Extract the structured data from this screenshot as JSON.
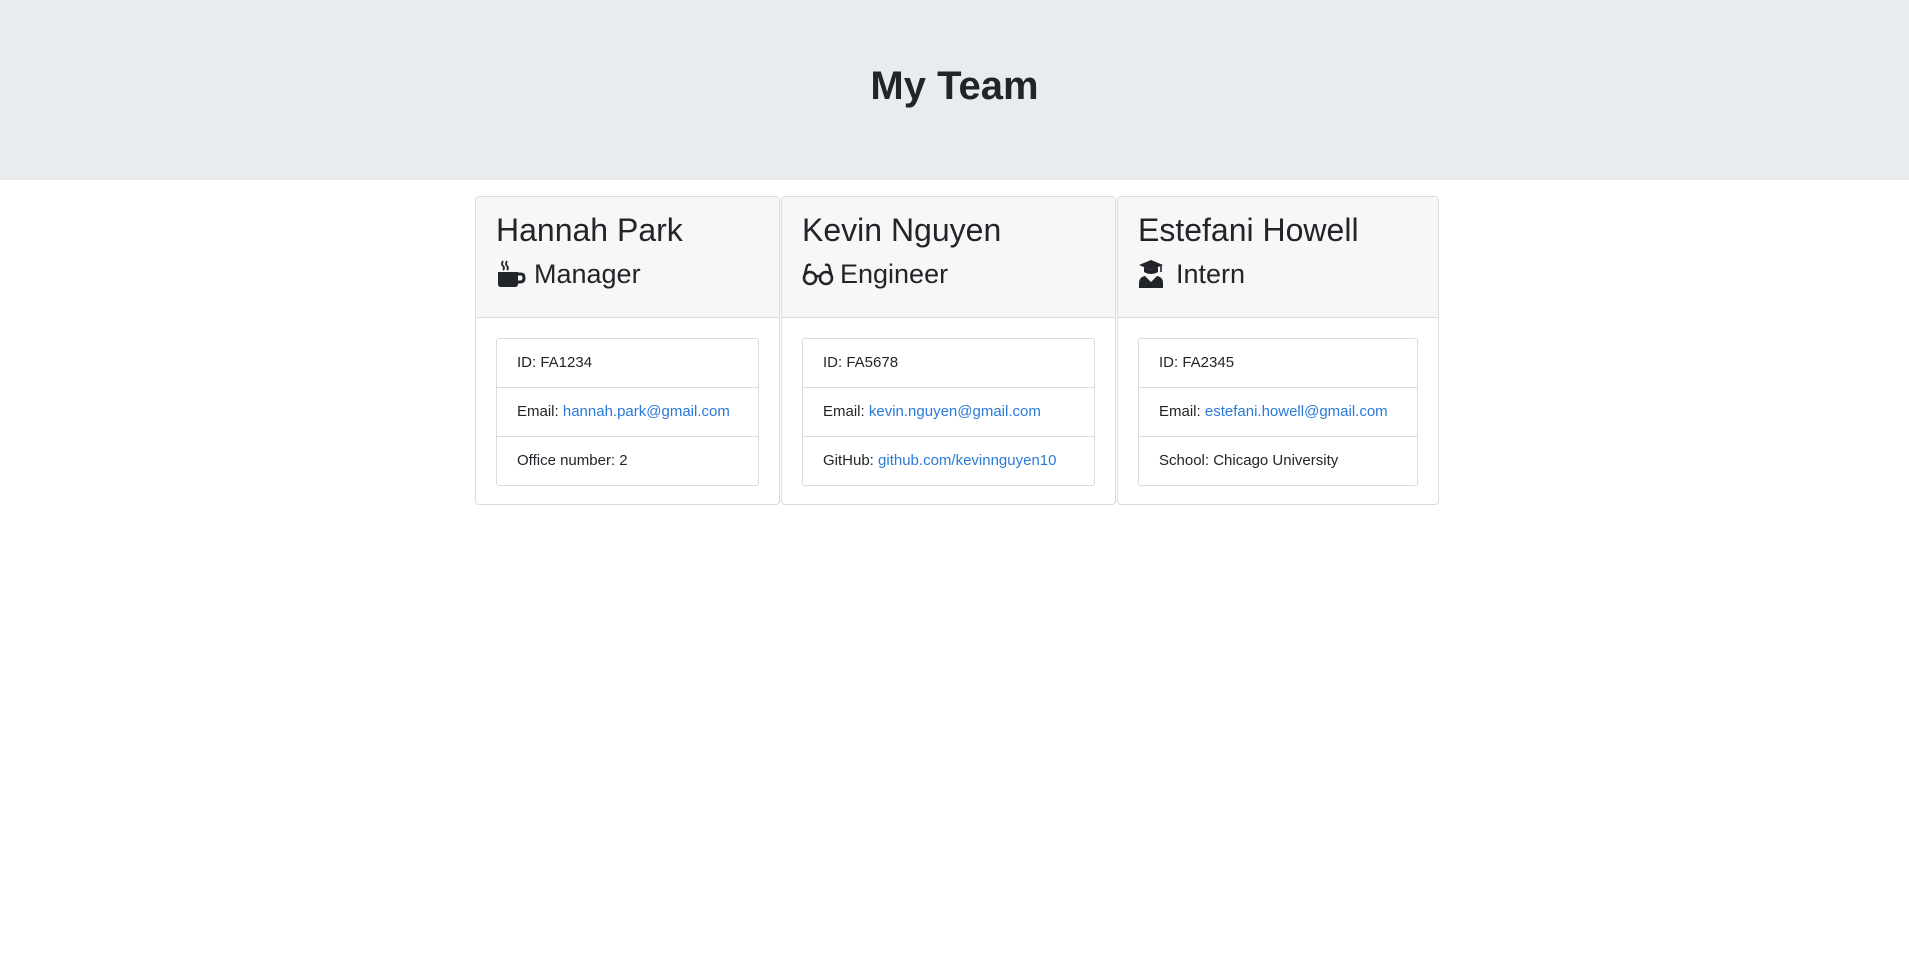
{
  "header": {
    "title": "My Team"
  },
  "employees": [
    {
      "name": "Hannah Park",
      "role": "Manager",
      "role_icon": "coffee-mug-icon",
      "id_label": "ID:",
      "id": "FA1234",
      "email_label": "Email:",
      "email": "hannah.park@gmail.com",
      "extra_label": "Office number:",
      "extra_value": "2"
    },
    {
      "name": "Kevin Nguyen",
      "role": "Engineer",
      "role_icon": "glasses-icon",
      "id_label": "ID:",
      "id": "FA5678",
      "email_label": "Email:",
      "email": "kevin.nguyen@gmail.com",
      "extra_label": "GitHub:",
      "extra_value": "github.com/kevinnguyen10"
    },
    {
      "name": "Estefani Howell",
      "role": "Intern",
      "role_icon": "graduate-icon",
      "id_label": "ID:",
      "id": "FA2345",
      "email_label": "Email:",
      "email": "estefani.howell@gmail.com",
      "extra_label": "School:",
      "extra_value": "Chicago University"
    }
  ],
  "colors": {
    "jumbotron_bg": "#e9ecef",
    "card_header_bg": "#f7f7f7",
    "link": "#2a7ad8",
    "text": "#212529"
  }
}
